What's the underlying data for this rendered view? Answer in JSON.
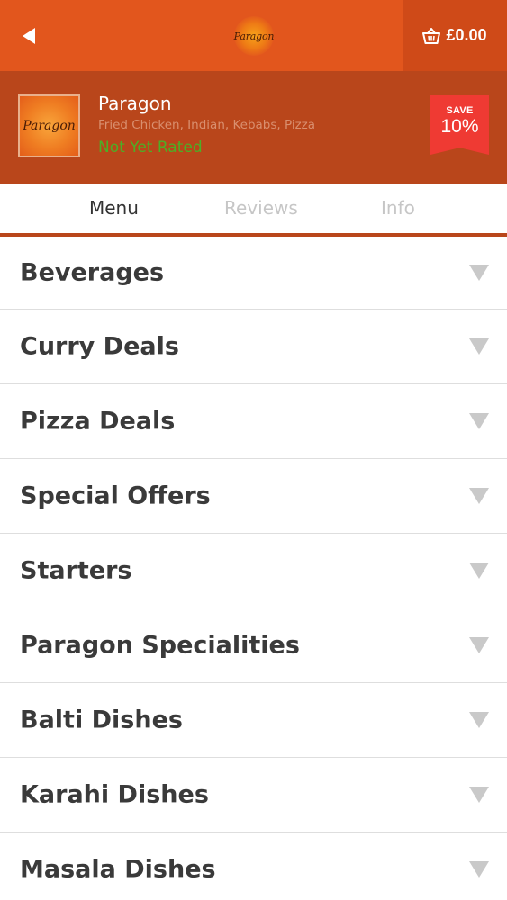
{
  "topbar": {
    "logo_text": "Paragon",
    "basket_total": "£0.00",
    "colors": {
      "bar": "#e2561d",
      "basket": "#cf4a18"
    },
    "icons": {
      "back": "back-arrow-icon",
      "basket": "basket-icon"
    }
  },
  "restaurant": {
    "logo_text": "Paragon",
    "name": "Paragon",
    "cuisine": "Fried Chicken, Indian, Kebabs, Pizza",
    "rating": "Not Yet Rated",
    "save_label": "SAVE",
    "save_percent": "10%",
    "colors": {
      "header": "#b9461b",
      "rating": "#4caf26",
      "badge": "#ef3a33"
    }
  },
  "tabs": [
    {
      "label": "Menu",
      "active": true
    },
    {
      "label": "Reviews",
      "active": false
    },
    {
      "label": "Info",
      "active": false
    }
  ],
  "categories": [
    {
      "label": "Beverages",
      "icon": "chevron-down-icon"
    },
    {
      "label": "Curry Deals",
      "icon": "chevron-down-icon"
    },
    {
      "label": "Pizza Deals",
      "icon": "chevron-down-icon"
    },
    {
      "label": "Special Offers",
      "icon": "chevron-down-icon"
    },
    {
      "label": "Starters",
      "icon": "chevron-down-icon"
    },
    {
      "label": "Paragon Specialities",
      "icon": "chevron-down-icon"
    },
    {
      "label": "Balti Dishes",
      "icon": "chevron-down-icon"
    },
    {
      "label": "Karahi Dishes",
      "icon": "chevron-down-icon"
    },
    {
      "label": "Masala Dishes",
      "icon": "chevron-down-icon"
    }
  ]
}
